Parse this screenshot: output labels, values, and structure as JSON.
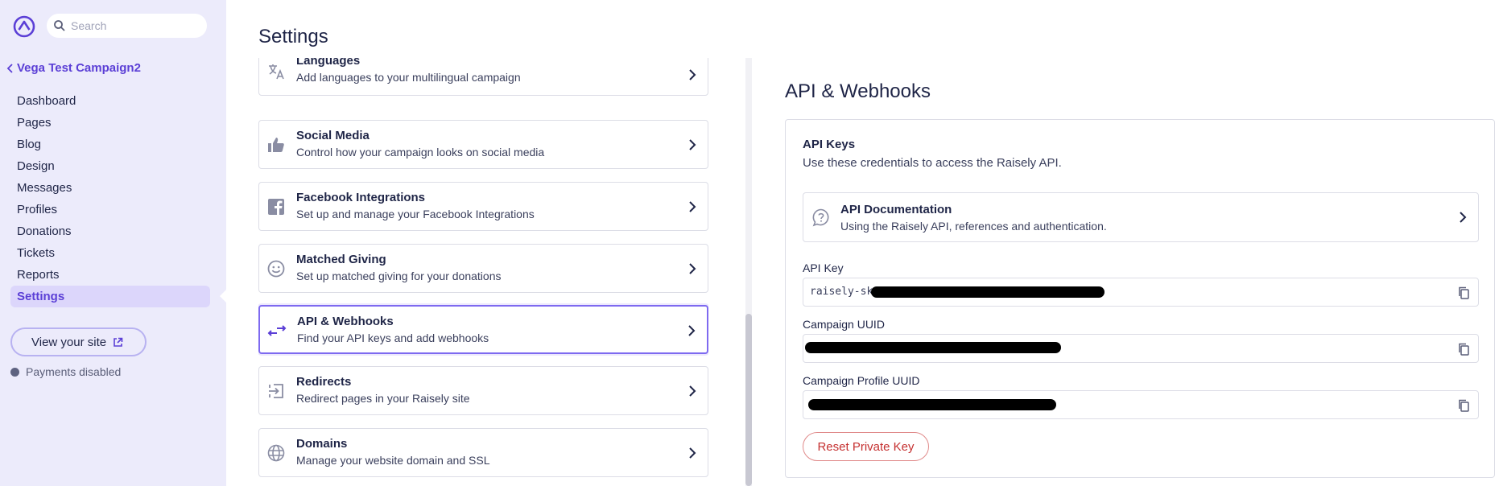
{
  "sidebar": {
    "search_placeholder": "Search",
    "campaign_name": "Vega Test Campaign2",
    "nav": [
      "Dashboard",
      "Pages",
      "Blog",
      "Design",
      "Messages",
      "Profiles",
      "Donations",
      "Tickets",
      "Reports",
      "Settings"
    ],
    "active_nav": "Settings",
    "view_site_label": "View your site",
    "payments_status": "Payments disabled"
  },
  "main": {
    "title": "Settings",
    "items": [
      {
        "title": "Languages",
        "desc": "Add languages to your multilingual campaign",
        "icon": "translate-icon"
      },
      {
        "title": "Social Media",
        "desc": "Control how your campaign looks on social media",
        "icon": "thumbs-up-icon"
      },
      {
        "title": "Facebook Integrations",
        "desc": "Set up and manage your Facebook Integrations",
        "icon": "facebook-icon"
      },
      {
        "title": "Matched Giving",
        "desc": "Set up matched giving for your donations",
        "icon": "smiley-icon"
      },
      {
        "title": "API & Webhooks",
        "desc": "Find your API keys and add webhooks",
        "icon": "compare-arrows-icon"
      },
      {
        "title": "Redirects",
        "desc": "Redirect pages in your Raisely site",
        "icon": "redirect-icon"
      },
      {
        "title": "Domains",
        "desc": "Manage your website domain and SSL",
        "icon": "globe-icon"
      }
    ]
  },
  "panel": {
    "title": "API & Webhooks",
    "section_title": "API Keys",
    "section_desc": "Use these credentials to access the Raisely API.",
    "doc_title": "API Documentation",
    "doc_desc": "Using the Raisely API, references and authentication.",
    "api_key_label": "API Key",
    "api_key_value": "raisely-sk-",
    "campaign_uuid_label": "Campaign UUID",
    "campaign_uuid_value": "",
    "profile_uuid_label": "Campaign Profile UUID",
    "profile_uuid_value": "",
    "reset_label": "Reset Private Key"
  },
  "colors": {
    "accent": "#5b3fd6",
    "sidebar_bg": "#ecebfb",
    "danger": "#c53030"
  }
}
